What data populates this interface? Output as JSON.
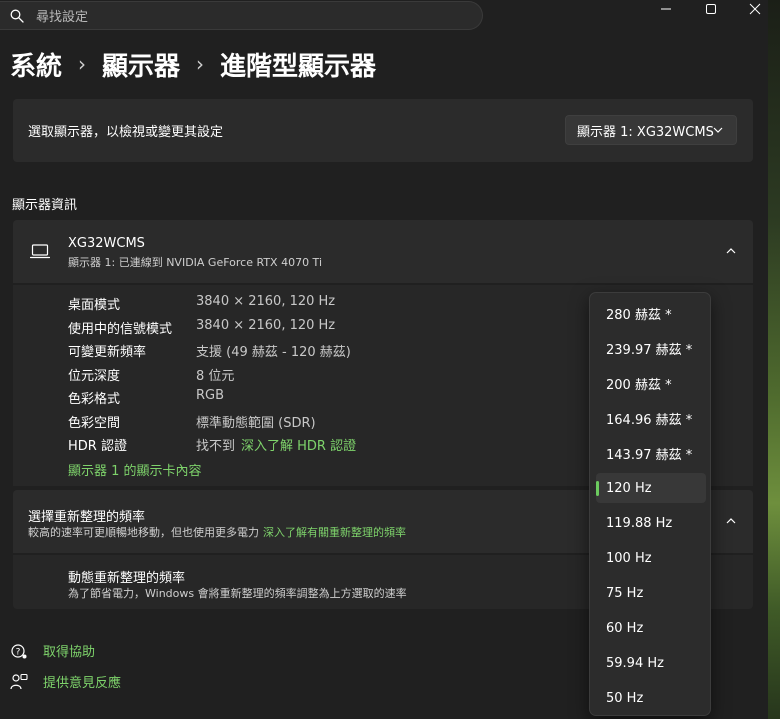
{
  "search": {
    "placeholder": "尋找設定"
  },
  "window_controls": {
    "minimize": "minimize",
    "maximize": "maximize",
    "close": "close"
  },
  "breadcrumb": {
    "items": [
      "系統",
      "顯示器",
      "進階型顯示器"
    ],
    "separator": "›"
  },
  "display_select": {
    "label": "選取顯示器，以檢視或變更其設定",
    "value": "顯示器 1: XG32WCMS"
  },
  "section_title": "顯示器資訊",
  "monitor": {
    "name": "XG32WCMS",
    "subtitle": "顯示器 1: 已連線到 NVIDIA GeForce RTX 4070 Ti"
  },
  "details": [
    {
      "key": "桌面模式",
      "value": "3840 × 2160, 120 Hz"
    },
    {
      "key": "使用中的信號模式",
      "value": "3840 × 2160, 120 Hz"
    },
    {
      "key": "可變更新頻率",
      "value": "支援 (49 赫茲 - 120 赫茲)"
    },
    {
      "key": "位元深度",
      "value": "8 位元"
    },
    {
      "key": "色彩格式",
      "value": "RGB"
    },
    {
      "key": "色彩空間",
      "value": "標準動態範圍 (SDR)"
    },
    {
      "key": "HDR 認證",
      "value": "找不到",
      "link": "深入了解 HDR 認證"
    }
  ],
  "gpu_link": "顯示器 1 的顯示卡內容",
  "refresh_rate": {
    "title": "選擇重新整理的頻率",
    "description": "較高的速率可更順暢地移動，但也使用更多電力",
    "link": "深入了解有關重新整理的頻率"
  },
  "dynamic_refresh": {
    "title": "動態重新整理的頻率",
    "description": "為了節省電力，Windows 會將重新整理的頻率調整為上方選取的速率"
  },
  "bottom_links": [
    "取得協助",
    "提供意見反應"
  ],
  "rate_options": [
    "280 赫茲 *",
    "239.97 赫茲 *",
    "200 赫茲 *",
    "164.96 赫茲 *",
    "143.97 赫茲 *",
    "120 Hz",
    "119.88 Hz",
    "100 Hz",
    "75 Hz",
    "60 Hz",
    "59.94 Hz",
    "50 Hz"
  ],
  "selected_rate": "120 Hz",
  "colors": {
    "accent": "#6ccb5f",
    "link": "#7ed36b",
    "background": "#202020",
    "card": "#2b2b2b"
  }
}
